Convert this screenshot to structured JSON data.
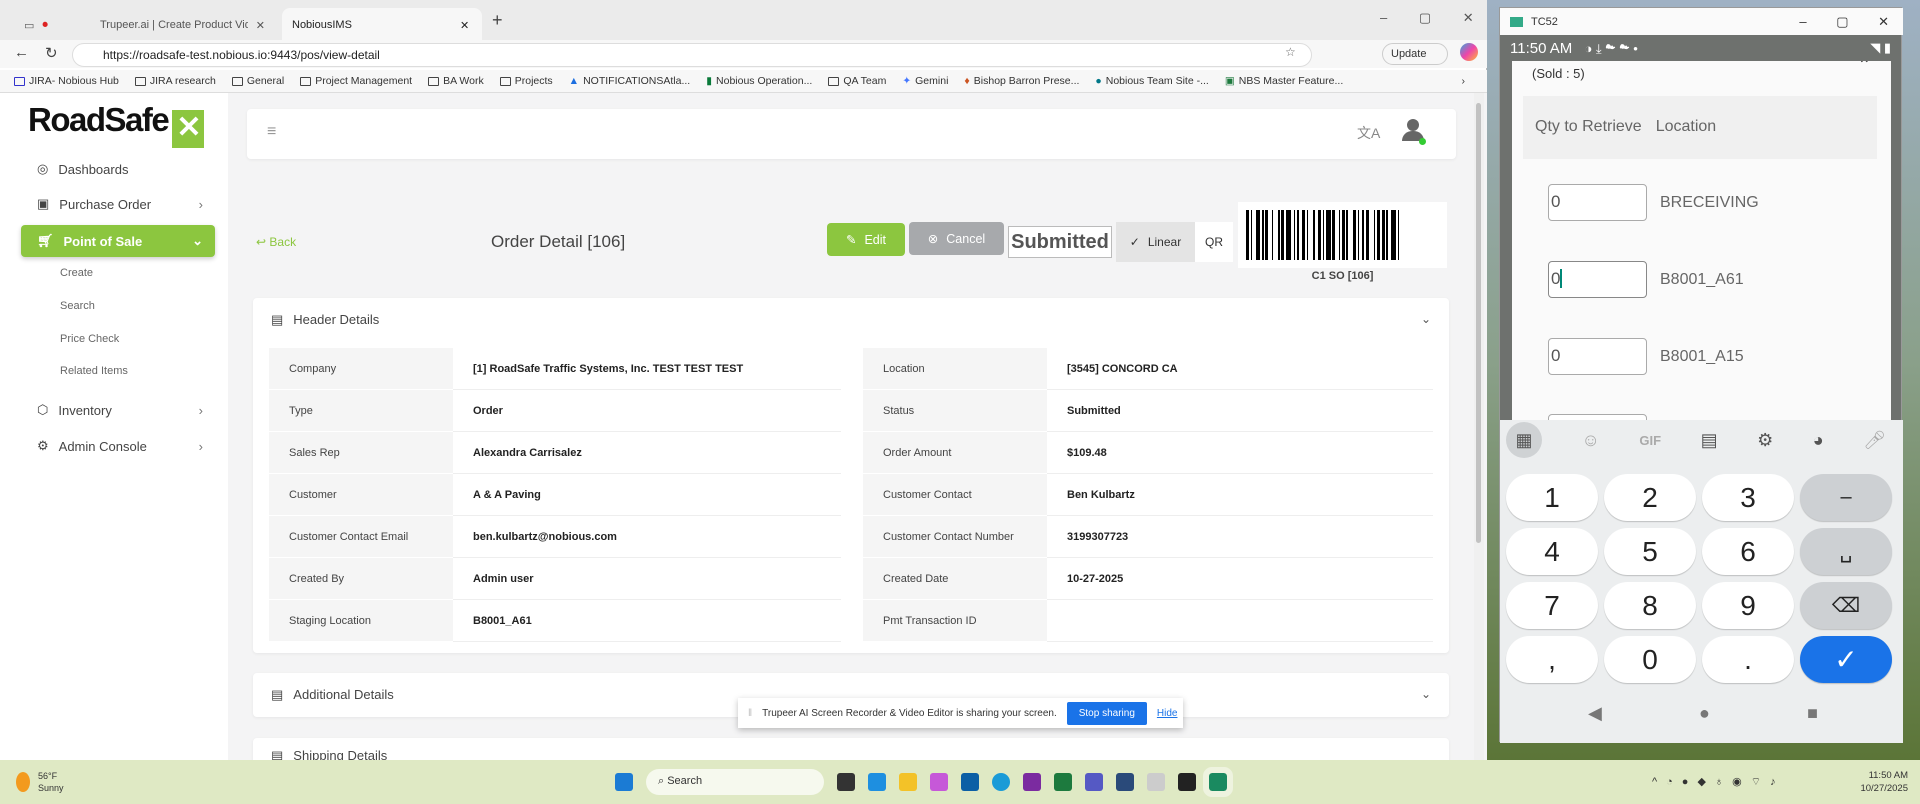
{
  "browser": {
    "tabs": [
      {
        "label": "Trupeer.ai | Create Product Video"
      },
      {
        "label": "NobiousIMS"
      }
    ],
    "url": "https://roadsafe-test.nobious.io:9443/pos/view-detail",
    "update_label": "Update",
    "bookmarks": [
      "JIRA- Nobious Hub",
      "JIRA research",
      "General",
      "Project Management",
      "BA Work",
      "Projects",
      "NOTIFICATIONSAtla...",
      "Nobious Operation...",
      "QA Team",
      "Gemini",
      "Bishop Barron Prese...",
      "Nobious Team Site -...",
      "NBS Master Feature..."
    ]
  },
  "sidebar": {
    "logo": "RoadSafe",
    "items": [
      {
        "label": "Dashboards"
      },
      {
        "label": "Purchase Order"
      },
      {
        "label": "Point of Sale"
      },
      {
        "label": "Inventory"
      },
      {
        "label": "Admin Console"
      }
    ],
    "subitems": [
      "Create",
      "Search",
      "Price Check",
      "Related Items"
    ]
  },
  "page": {
    "back": "Back",
    "title": "Order Detail [106]",
    "edit": "Edit",
    "cancel": "Cancel",
    "status": "Submitted",
    "toggle": {
      "linear": "Linear",
      "qr": "QR",
      "selected": "Linear"
    },
    "barcode_caption": "C1 SO [106]"
  },
  "header_details": {
    "title": "Header Details",
    "left": [
      [
        "Company",
        "[1] RoadSafe Traffic Systems, Inc. TEST TEST TEST"
      ],
      [
        "Type",
        "Order"
      ],
      [
        "Sales Rep",
        "Alexandra Carrisalez"
      ],
      [
        "Customer",
        "A & A Paving"
      ],
      [
        "Customer Contact Email",
        "ben.kulbartz@nobious.com"
      ],
      [
        "Created By",
        "Admin user"
      ],
      [
        "Staging Location",
        "B8001_A61"
      ]
    ],
    "right": [
      [
        "Location",
        "[3545] CONCORD CA"
      ],
      [
        "Status",
        "Submitted"
      ],
      [
        "Order Amount",
        "$109.48"
      ],
      [
        "Customer Contact",
        "Ben Kulbartz"
      ],
      [
        "Customer Contact Number",
        "3199307723"
      ],
      [
        "Created Date",
        "10-27-2025"
      ],
      [
        "Pmt Transaction ID",
        ""
      ]
    ]
  },
  "additional_details": {
    "title": "Additional Details"
  },
  "shipping_details": {
    "title": "Shipping Details"
  },
  "share_banner": {
    "text": "Trupeer AI Screen Recorder & Video Editor is sharing your screen.",
    "stop": "Stop sharing",
    "hide": "Hide"
  },
  "phone": {
    "window_title": "TC52",
    "time": "11:50 AM",
    "sold": "(Sold : 5)",
    "col_qty": "Qty to Retrieve",
    "col_location": "Location",
    "rows": [
      {
        "qty": "0",
        "location": "BRECEIVING"
      },
      {
        "qty": "0",
        "location": "B8001_A61"
      },
      {
        "qty": "0",
        "location": "B8001_A15"
      }
    ],
    "keys": [
      "1",
      "2",
      "3",
      "–",
      "4",
      "5",
      "6",
      "␣",
      "7",
      "8",
      "9",
      "⌫",
      ",",
      "0",
      ".",
      "✓"
    ],
    "gif": "GIF"
  },
  "taskbar": {
    "weather_temp": "56°F",
    "weather_desc": "Sunny",
    "search": "Search",
    "time": "11:50 AM",
    "date": "10/27/2025"
  },
  "colors": {
    "brand_green": "#8cc63f",
    "blue": "#1a73e8"
  }
}
